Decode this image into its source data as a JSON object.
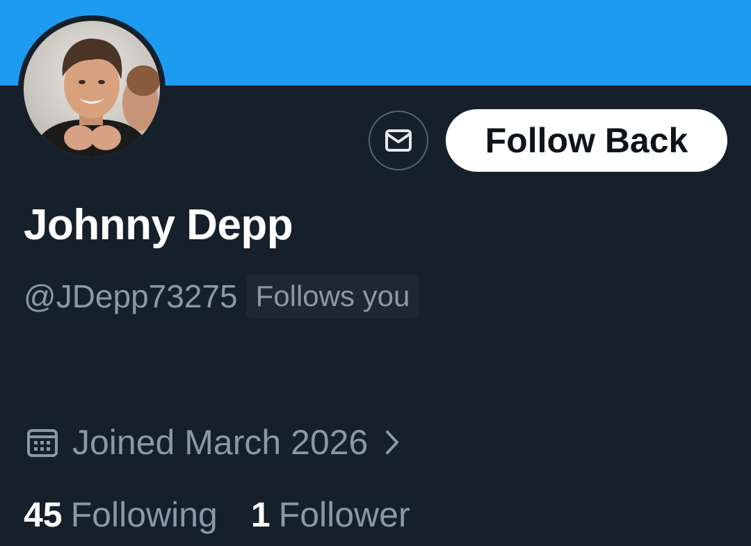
{
  "profile": {
    "display_name": "Johnny Depp",
    "handle": "@JDepp73275",
    "follows_you_badge": "Follows you",
    "joined": "Joined March 2026",
    "avatar_alt": "profile-photo"
  },
  "actions": {
    "follow_back_label": "Follow Back",
    "message_icon": "mail-icon"
  },
  "stats": {
    "following_count": "45",
    "following_label": "Following",
    "followers_count": "1",
    "followers_label": "Follower"
  },
  "colors": {
    "banner": "#1d9bf0",
    "background": "#15202b",
    "secondary_text": "#8b98a5",
    "primary_text": "#ffffff"
  }
}
